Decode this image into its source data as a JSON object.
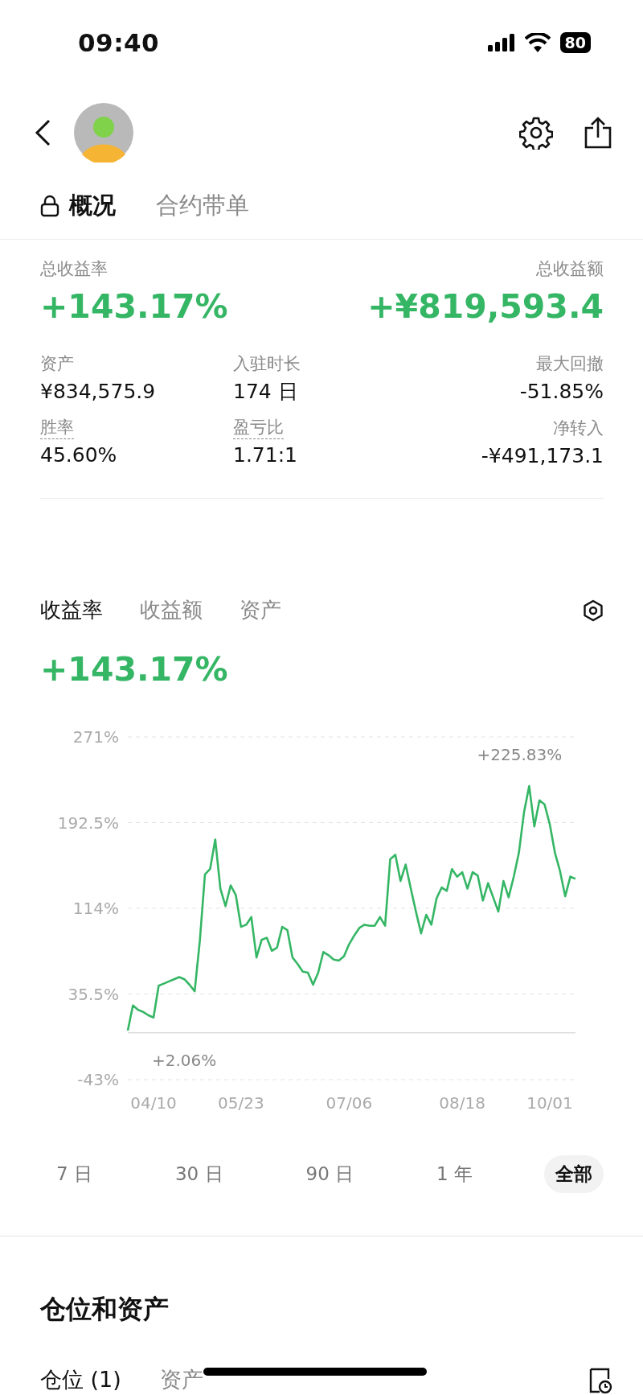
{
  "status_bar": {
    "time": "09:40",
    "battery": "80"
  },
  "tabs": [
    {
      "label": "概况",
      "selected": true,
      "locked": true
    },
    {
      "label": "合约带单",
      "selected": false,
      "locked": false
    }
  ],
  "summary": {
    "rate_label": "总收益率",
    "rate": "+143.17%",
    "amount_label": "总收益额",
    "amount": "+¥819,593.4"
  },
  "stats": [
    {
      "label": "资产",
      "value": "¥834,575.9",
      "dashed": false
    },
    {
      "label": "入驻时长",
      "value": "174 日",
      "dashed": false
    },
    {
      "label": "最大回撤",
      "value": "-51.85%",
      "dashed": false
    },
    {
      "label": "胜率",
      "value": "45.60%",
      "dashed": true
    },
    {
      "label": "盈亏比",
      "value": "1.71:1",
      "dashed": true
    },
    {
      "label": "净转入",
      "value": "-¥491,173.1",
      "dashed": false
    }
  ],
  "chart_tabs": [
    {
      "label": "收益率",
      "selected": true
    },
    {
      "label": "收益额",
      "selected": false
    },
    {
      "label": "资产",
      "selected": false
    }
  ],
  "current_value": "+143.17%",
  "chart_data": {
    "type": "line",
    "categories": [
      null,
      null,
      null,
      null,
      null,
      "04/10",
      null,
      null,
      null,
      null,
      null,
      null,
      null,
      null,
      null,
      null,
      null,
      null,
      null,
      null,
      null,
      null,
      "05/23",
      null,
      null,
      null,
      null,
      null,
      null,
      null,
      null,
      null,
      null,
      null,
      null,
      null,
      null,
      null,
      null,
      null,
      null,
      null,
      null,
      "07/06",
      null,
      null,
      null,
      null,
      null,
      null,
      null,
      null,
      null,
      null,
      null,
      null,
      null,
      null,
      null,
      null,
      null,
      null,
      null,
      null,
      null,
      "08/18",
      null,
      null,
      null,
      null,
      null,
      null,
      null,
      null,
      null,
      null,
      null,
      null,
      null,
      null,
      null,
      null,
      "10/01",
      null,
      null,
      null,
      null,
      null
    ],
    "series": [
      {
        "color": "#35b665",
        "values": [
          2,
          25,
          21,
          19,
          16,
          14,
          43,
          45,
          47,
          49,
          51,
          49,
          44,
          38,
          84,
          145,
          150,
          177,
          132,
          116,
          135,
          126,
          97,
          99,
          106,
          69,
          85,
          87,
          75,
          78,
          97,
          94,
          69,
          63,
          56,
          55,
          44,
          55,
          74,
          71,
          67,
          66,
          70,
          81,
          89,
          96,
          99,
          98,
          98,
          106,
          98,
          159,
          163,
          139,
          154,
          132,
          111,
          91,
          108,
          99,
          123,
          133,
          130,
          150,
          143,
          147,
          132,
          147,
          144,
          121,
          137,
          124,
          111,
          139,
          124,
          143,
          165,
          202,
          226,
          189,
          213,
          209,
          191,
          165,
          148,
          125,
          143,
          141
        ]
      }
    ],
    "ylim": [
      -43,
      271
    ],
    "yticks": [
      {
        "value": 271,
        "label": "271%"
      },
      {
        "value": 192.5,
        "label": "192.5%"
      },
      {
        "value": 114,
        "label": "114%"
      },
      {
        "value": 35.5,
        "label": "35.5%"
      },
      {
        "value": -43,
        "label": "-43%"
      }
    ],
    "grid": true,
    "annotations": [
      "+225.83%",
      "+2.06%"
    ]
  },
  "periods": [
    {
      "label": "7 日",
      "selected": false
    },
    {
      "label": "30 日",
      "selected": false
    },
    {
      "label": "90 日",
      "selected": false
    },
    {
      "label": "1 年",
      "selected": false
    },
    {
      "label": "全部",
      "selected": true
    }
  ],
  "positions": {
    "title": "仓位和资产",
    "tabs": [
      {
        "label": "仓位 (1)",
        "selected": true
      },
      {
        "label": "资产",
        "selected": false
      }
    ]
  }
}
